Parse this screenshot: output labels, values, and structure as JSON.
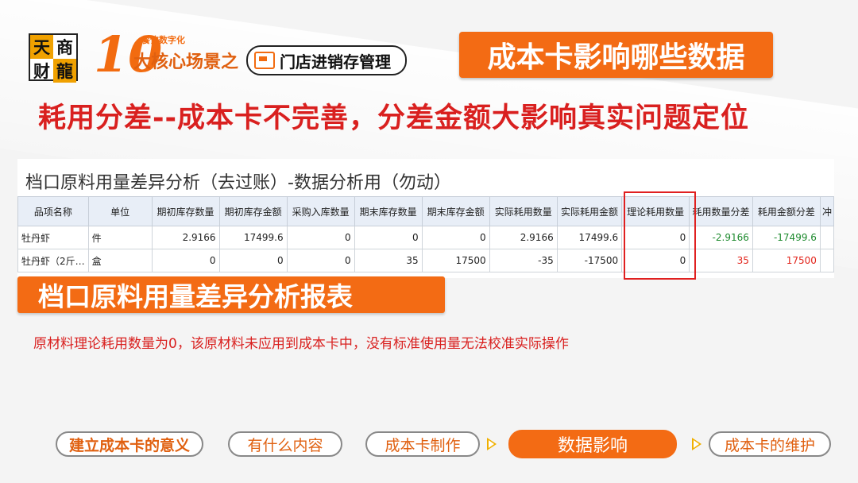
{
  "brand": {
    "logo_chars": [
      "天",
      "商",
      "财",
      "龍"
    ],
    "number": "10",
    "small_tag": "餐饮数字化",
    "lead": "大核心场景之",
    "store_label": "门店进销存管理"
  },
  "title": "成本卡影响哪些数据",
  "headline": "耗用分差--成本卡不完善，分差金额大影响真实问题定位",
  "report": {
    "title": "档口原料用量差异分析（去过账）-数据分析用（勿动）",
    "columns": [
      "品项名称",
      "单位",
      "期初库存数量",
      "期初库存金额",
      "采购入库数量",
      "期末库存数量",
      "期末库存金额",
      "实际耗用数量",
      "实际耗用金额",
      "理论耗用数量",
      "耗用数量分差",
      "耗用金额分差",
      "冲"
    ],
    "rows": [
      [
        "牡丹虾",
        "件",
        "2.9166",
        "17499.6",
        "0",
        "0",
        "0",
        "2.9166",
        "17499.6",
        "0",
        "-2.9166",
        "-17499.6",
        ""
      ],
      [
        "牡丹虾（2斤…",
        "盒",
        "0",
        "0",
        "0",
        "35",
        "17500",
        "-35",
        "-17500",
        "0",
        "35",
        "17500",
        ""
      ]
    ]
  },
  "report_tag": "档口原料用量差异分析报表",
  "note": "原材料理论耗用数量为0，该原材料未应用到成本卡中，没有标准使用量无法校准实际操作",
  "nav": [
    "建立成本卡的意义",
    "有什么内容",
    "成本卡制作",
    "数据影响",
    "成本卡的维护"
  ],
  "colors": {
    "accent": "#f36b14",
    "alert": "#d9201f",
    "negative": "#1d8a2e",
    "positive": "#e2231a"
  }
}
